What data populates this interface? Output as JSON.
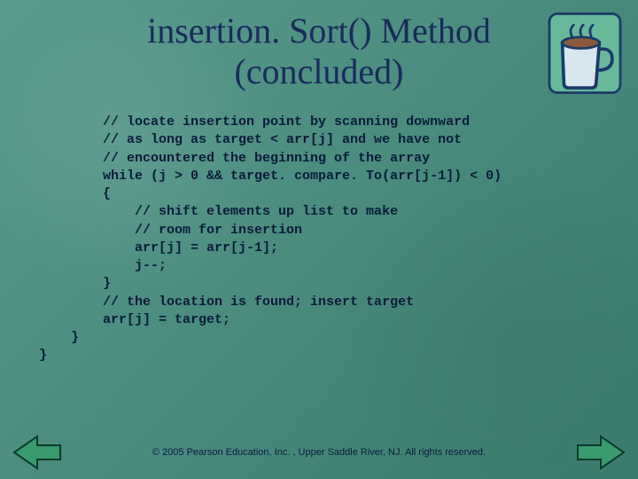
{
  "title_line1": "insertion. Sort() Method",
  "title_line2": "(concluded)",
  "code": "        // locate insertion point by scanning downward\n        // as long as target < arr[j] and we have not\n        // encountered the beginning of the array\n        while (j > 0 && target. compare. To(arr[j-1]) < 0)\n        {\n            // shift elements up list to make\n            // room for insertion\n            arr[j] = arr[j-1];\n            j--;\n        }\n        // the location is found; insert target\n        arr[j] = target;\n    }\n}",
  "footer": "© 2005 Pearson Education, Inc. , Upper Saddle River, NJ.  All rights reserved.",
  "icons": {
    "coffee": "coffee-cup-icon",
    "prev": "nav-prev-arrow",
    "next": "nav-next-arrow"
  }
}
